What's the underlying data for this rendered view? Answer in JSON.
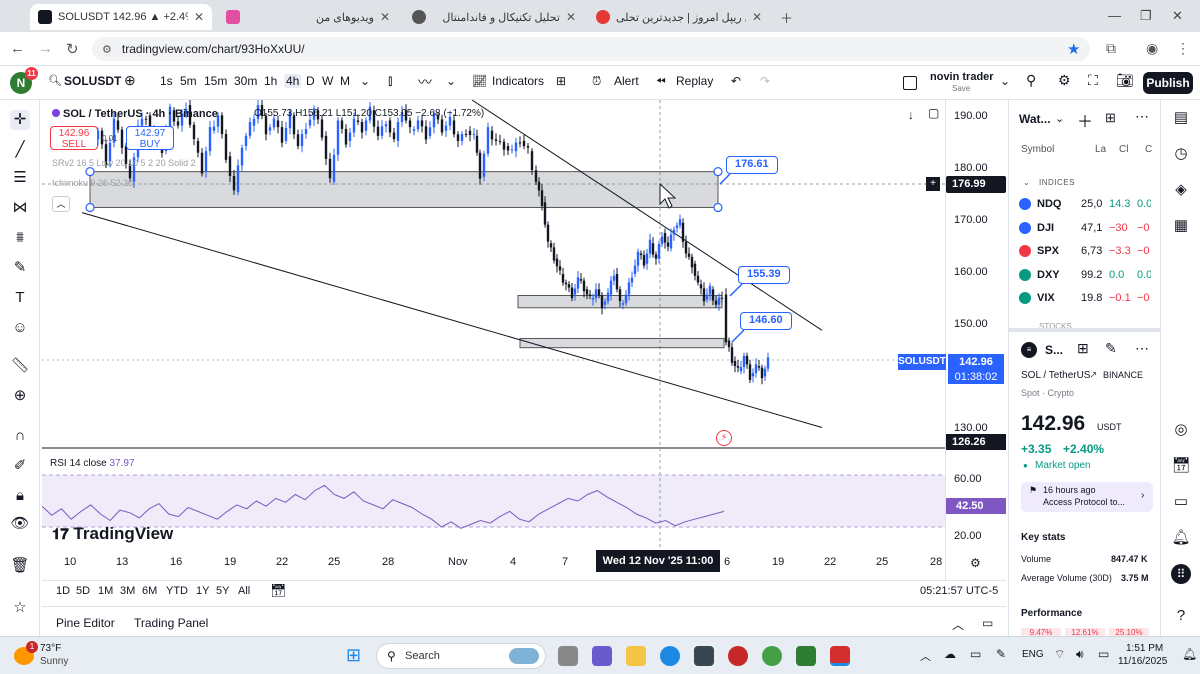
{
  "browser": {
    "tabs": [
      {
        "title": "SOLUSDT 142.96 ▲ +2.4% novi",
        "active": true
      },
      {
        "title": "ویدیوهای من",
        "active": false
      },
      {
        "title": "تحلیل تکنیکال و فاندامنتال",
        "active": false
      },
      {
        "title": "تحلیل ریپل امروز | جدیدترین تحلی",
        "active": false
      }
    ],
    "url": "tradingview.com/chart/93HoXxUU/"
  },
  "toolbar": {
    "avatar_letter": "N",
    "avatar_badge": "11",
    "symbol": "SOLUSDT",
    "intervals": [
      "1s",
      "5m",
      "15m",
      "30m",
      "1h",
      "4h",
      "D",
      "W",
      "M"
    ],
    "active_interval": "4h",
    "indicators_label": "Indicators",
    "alert_label": "Alert",
    "replay_label": "Replay",
    "layout_name": "novin trader",
    "layout_status": "Save",
    "publish_label": "Publish"
  },
  "legend": {
    "title": "SOL / TetherUS · 4h · Binance",
    "ohlc": "O155.73 H156.21 L151.20 C153.05 −2.68 (−1.72%)",
    "sell_price": "142.96",
    "sell_label": "SELL",
    "spread": "0.01",
    "buy_price": "142.97",
    "buy_label": "BUY",
    "indicator1": "SRv2 16 5 Low 20 10 5 2 20 Solid 2",
    "indicator2": "Ichimoku 9 26 52 26"
  },
  "annotations": [
    {
      "value": "176.61",
      "label": "176.61"
    },
    {
      "value": "155.39",
      "label": "155.39"
    },
    {
      "value": "146.60",
      "label": "146.60"
    }
  ],
  "price_scale": {
    "ticks": [
      "190.00",
      "180.00",
      "170.00",
      "160.00",
      "150.00",
      "130.00"
    ],
    "cursor_price": "176.99",
    "last_symbol": "SOLUSDT",
    "last_price": "142.96",
    "countdown": "01:38:02",
    "low_marker": "126.26",
    "rsi_ticks": [
      "60.00",
      "20.00"
    ],
    "rsi_value": "42.50"
  },
  "rsi": {
    "label": "RSI 14 close",
    "value": "37.97"
  },
  "branding": "TradingView",
  "time_axis": {
    "ticks": [
      "10",
      "13",
      "16",
      "19",
      "22",
      "25",
      "28",
      "Nov",
      "4",
      "7",
      "6",
      "19",
      "22",
      "25",
      "28"
    ],
    "cursor_label": "Wed 12 Nov '25   11:00"
  },
  "timeframes": [
    "1D",
    "5D",
    "1M",
    "3M",
    "6M",
    "YTD",
    "1Y",
    "5Y",
    "All"
  ],
  "clock_tz": "05:21:57 UTC-5",
  "bottom_tabs": [
    "Pine Editor",
    "Trading Panel"
  ],
  "watchlist": {
    "title": "Wat...",
    "columns": [
      "Symbol",
      "La",
      "Cl",
      "C"
    ],
    "section": "INDICES",
    "rows": [
      {
        "sym": "NDQ",
        "last": "25,0",
        "chg": "14.3",
        "pct": "0.0",
        "color": "#2962ff",
        "neg": false
      },
      {
        "sym": "DJI",
        "last": "47,1",
        "chg": "−30",
        "pct": "−0",
        "color": "#2962ff",
        "neg": true
      },
      {
        "sym": "SPX",
        "last": "6,73",
        "chg": "−3.3",
        "pct": "−0",
        "color": "#f23645",
        "neg": true
      },
      {
        "sym": "DXY",
        "last": "99.2",
        "chg": "0.0",
        "pct": "0.0",
        "color": "#089981",
        "neg": false
      },
      {
        "sym": "VIX",
        "last": "19.8",
        "chg": "−0.1",
        "pct": "−0",
        "color": "#089981",
        "neg": true
      }
    ],
    "stocks_section": "STOCKS"
  },
  "details": {
    "short": "S...",
    "name": "SOL / TetherUS",
    "exchange": "BINANCE",
    "type": "Spot · Crypto",
    "price": "142.96",
    "currency": "USDT",
    "change": "+3.35",
    "change_pct": "+2.40%",
    "market_status": "Market open",
    "news_time": "16 hours ago",
    "news_title": "Access Protocol to...",
    "key_stats_title": "Key stats",
    "volume_label": "Volume",
    "volume_value": "847.47 K",
    "avg_volume_label": "Average Volume (30D)",
    "avg_volume_value": "3.75 M",
    "performance_label": "Performance",
    "perf_values": [
      "9.47%",
      "12.61%",
      "25.10%"
    ]
  },
  "taskbar": {
    "weather_temp": "73°F",
    "weather_desc": "Sunny",
    "weather_badge": "1",
    "search_label": "Search",
    "language": "ENG",
    "time": "1:51 PM",
    "date": "11/16/2025"
  },
  "chart_data": {
    "type": "candlestick",
    "title": "SOL / TetherUS · 4h · Binance",
    "xlabel": "",
    "ylabel": "",
    "ylim": [
      126,
      194
    ],
    "price_path": [
      [
        0,
        186
      ],
      [
        8,
        188
      ],
      [
        16,
        182
      ],
      [
        24,
        190
      ],
      [
        32,
        185
      ],
      [
        40,
        178
      ],
      [
        48,
        189
      ],
      [
        56,
        191
      ],
      [
        64,
        186
      ],
      [
        72,
        184
      ],
      [
        80,
        192
      ],
      [
        88,
        189
      ],
      [
        96,
        193
      ],
      [
        104,
        186
      ],
      [
        112,
        180
      ],
      [
        120,
        188
      ],
      [
        128,
        191
      ],
      [
        136,
        183
      ],
      [
        144,
        176
      ],
      [
        152,
        185
      ],
      [
        160,
        189
      ],
      [
        168,
        193
      ],
      [
        176,
        188
      ],
      [
        184,
        190
      ],
      [
        192,
        186
      ],
      [
        200,
        191
      ],
      [
        208,
        185
      ],
      [
        216,
        189
      ],
      [
        224,
        192
      ],
      [
        232,
        187
      ],
      [
        240,
        178
      ],
      [
        248,
        190
      ],
      [
        256,
        186
      ],
      [
        264,
        190
      ],
      [
        272,
        188
      ],
      [
        280,
        192
      ],
      [
        288,
        187
      ],
      [
        296,
        190
      ],
      [
        304,
        186
      ],
      [
        312,
        192
      ],
      [
        320,
        188
      ],
      [
        328,
        190
      ],
      [
        336,
        187
      ],
      [
        344,
        191
      ],
      [
        352,
        188
      ],
      [
        360,
        190
      ],
      [
        368,
        186
      ],
      [
        376,
        188
      ],
      [
        384,
        187
      ],
      [
        390,
        179
      ],
      [
        398,
        188
      ],
      [
        406,
        186
      ],
      [
        414,
        185
      ],
      [
        422,
        184
      ],
      [
        430,
        186
      ],
      [
        438,
        184
      ],
      [
        446,
        178
      ],
      [
        452,
        174
      ],
      [
        458,
        166
      ],
      [
        464,
        163
      ],
      [
        470,
        160
      ],
      [
        476,
        158
      ],
      [
        482,
        156
      ],
      [
        488,
        159
      ],
      [
        494,
        157
      ],
      [
        500,
        155
      ],
      [
        506,
        157
      ],
      [
        512,
        154
      ],
      [
        518,
        156
      ],
      [
        524,
        160
      ],
      [
        530,
        154
      ],
      [
        536,
        156
      ],
      [
        542,
        160
      ],
      [
        548,
        164
      ],
      [
        554,
        162
      ],
      [
        560,
        166
      ],
      [
        566,
        163
      ],
      [
        572,
        168
      ],
      [
        578,
        165
      ],
      [
        584,
        169
      ],
      [
        590,
        170
      ],
      [
        596,
        164
      ],
      [
        602,
        162
      ],
      [
        608,
        158
      ],
      [
        614,
        155
      ],
      [
        620,
        157
      ],
      [
        626,
        154
      ],
      [
        632,
        156
      ],
      [
        636,
        147
      ],
      [
        642,
        143
      ],
      [
        648,
        141
      ],
      [
        654,
        144
      ],
      [
        660,
        140
      ],
      [
        666,
        142
      ],
      [
        672,
        140
      ],
      [
        678,
        143
      ]
    ],
    "drawings": {
      "zones": [
        {
          "from": 173.0,
          "to": 180.0
        },
        {
          "from": 153.4,
          "to": 155.8
        },
        {
          "from": 145.6,
          "to": 147.4
        }
      ],
      "trendlines": [
        {
          "from": [
            40,
            172
          ],
          "to": [
            780,
            130
          ]
        },
        {
          "from": [
            430,
            194
          ],
          "to": [
            780,
            149
          ]
        }
      ]
    },
    "rsi_series": [
      46,
      39,
      44,
      36,
      42,
      47,
      40,
      35,
      43,
      41,
      37,
      44,
      48,
      40,
      38,
      45,
      42,
      39,
      36,
      42,
      47,
      44,
      50,
      46,
      52,
      49,
      55,
      51,
      58,
      62,
      55,
      52,
      57,
      50,
      47,
      44,
      51,
      48,
      45,
      40,
      36,
      30,
      34,
      29,
      32,
      35,
      33,
      38,
      42,
      36,
      34,
      40,
      44,
      48,
      52,
      50,
      55,
      58,
      53,
      49,
      45,
      40,
      37,
      33,
      35,
      31,
      34,
      36,
      38,
      40,
      42
    ]
  }
}
